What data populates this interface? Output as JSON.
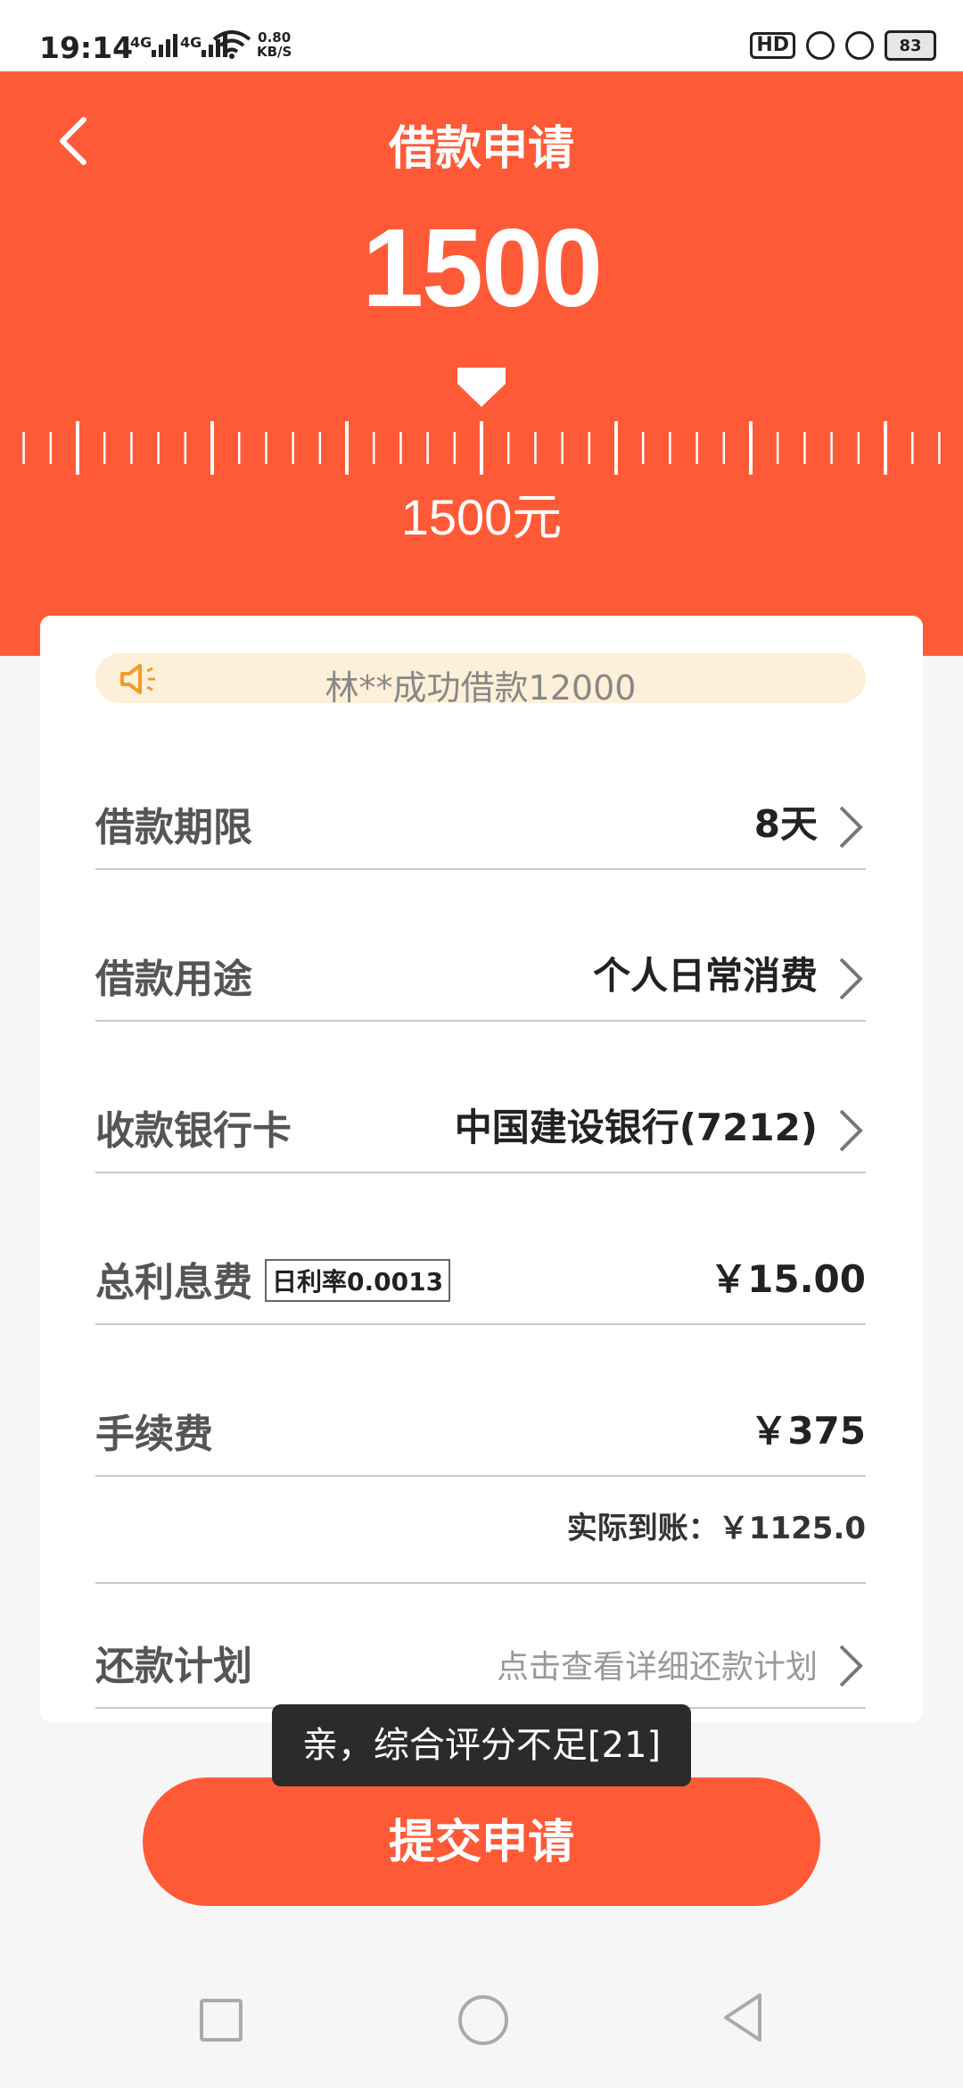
{
  "status_bar": {
    "time": "19:14",
    "signal_1": "4G",
    "signal_2": "4G",
    "speed_value": "0.80",
    "speed_unit": "KB/S",
    "hd_label": "HD",
    "battery": "83"
  },
  "header": {
    "title": "借款申请",
    "amount_display": "1500",
    "amount_label": "1500元",
    "background_color": "#ff5a38"
  },
  "notice": {
    "text": "林**成功借款12000"
  },
  "rows": {
    "term": {
      "label": "借款期限",
      "value": "8天"
    },
    "purpose": {
      "label": "借款用途",
      "value": "个人日常消费"
    },
    "bank_card": {
      "label": "收款银行卡",
      "value": "中国建设银行(7212)"
    },
    "interest": {
      "label": "总利息费",
      "badge": "日利率0.0013",
      "value": "￥15.00"
    },
    "fee": {
      "label": "手续费",
      "value": "￥375"
    },
    "actual": {
      "text": "实际到账：￥1125.0"
    },
    "plan": {
      "label": "还款计划",
      "value": "点击查看详细还款计划"
    }
  },
  "toast": {
    "text": "亲，综合评分不足[21]"
  },
  "submit": {
    "label": "提交申请"
  },
  "icons": {
    "back": "chevron-left-icon",
    "speaker": "speaker-icon",
    "row_arrow": "chevron-right-icon",
    "nav_recent": "square-icon",
    "nav_home": "circle-icon",
    "nav_back": "triangle-back-icon"
  }
}
